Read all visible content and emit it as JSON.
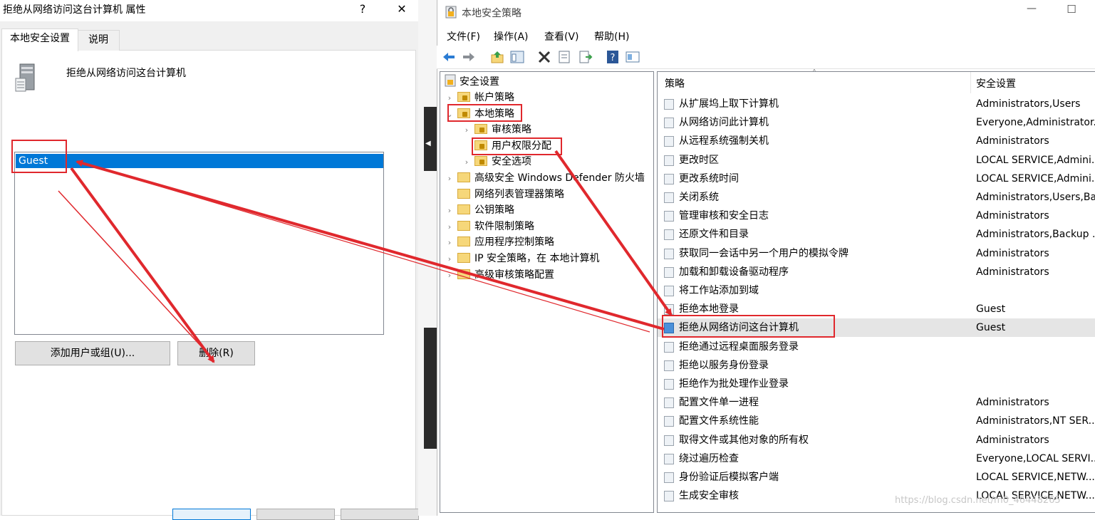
{
  "dialog": {
    "title": "拒绝从网络访问这台计算机 属性",
    "help_glyph": "?",
    "close_glyph": "✕",
    "tabs": [
      "本地安全设置",
      "说明"
    ],
    "policy_name": "拒绝从网络访问这台计算机",
    "members": [
      "Guest"
    ],
    "add_button": "添加用户或组(U)...",
    "remove_button": "删除(R)"
  },
  "mmc": {
    "title": "本地安全策略",
    "minimize_glyph": "—",
    "maximize_glyph": "☐",
    "menu": [
      "文件(F)",
      "操作(A)",
      "查看(V)",
      "帮助(H)"
    ],
    "toolbar_icons": [
      "back-arrow-icon",
      "forward-arrow-icon",
      "up-folder-icon",
      "show-hide-tree-icon",
      "delete-icon",
      "properties-icon",
      "export-list-icon",
      "help-icon",
      "console-icon"
    ],
    "tree": {
      "root": "安全设置",
      "items": [
        {
          "label": "帐户策略",
          "level": 1,
          "expander": "›",
          "lock": true
        },
        {
          "label": "本地策略",
          "level": 1,
          "expander": "⌄",
          "lock": true
        },
        {
          "label": "审核策略",
          "level": 2,
          "expander": "›",
          "lock": true
        },
        {
          "label": "用户权限分配",
          "level": 2,
          "expander": "",
          "lock": true
        },
        {
          "label": "安全选项",
          "level": 2,
          "expander": "›",
          "lock": true
        },
        {
          "label": "高级安全 Windows Defender 防火墙",
          "level": 1,
          "expander": "›",
          "lock": false
        },
        {
          "label": "网络列表管理器策略",
          "level": 1,
          "expander": "",
          "lock": false
        },
        {
          "label": "公钥策略",
          "level": 1,
          "expander": "›",
          "lock": false
        },
        {
          "label": "软件限制策略",
          "level": 1,
          "expander": "›",
          "lock": false
        },
        {
          "label": "应用程序控制策略",
          "level": 1,
          "expander": "›",
          "lock": false
        },
        {
          "label": "IP 安全策略，在 本地计算机",
          "level": 1,
          "expander": "›",
          "lock": false
        },
        {
          "label": "高级审核策略配置",
          "level": 1,
          "expander": "›",
          "lock": false
        }
      ]
    },
    "columns": [
      "策略",
      "安全设置"
    ],
    "sort_glyph": "˄",
    "policies": [
      {
        "name": "从扩展坞上取下计算机",
        "setting": "Administrators,Users"
      },
      {
        "name": "从网络访问此计算机",
        "setting": "Everyone,Administrator..."
      },
      {
        "name": "从远程系统强制关机",
        "setting": "Administrators"
      },
      {
        "name": "更改时区",
        "setting": "LOCAL SERVICE,Admini..."
      },
      {
        "name": "更改系统时间",
        "setting": "LOCAL SERVICE,Admini..."
      },
      {
        "name": "关闭系统",
        "setting": "Administrators,Users,Ba..."
      },
      {
        "name": "管理审核和安全日志",
        "setting": "Administrators"
      },
      {
        "name": "还原文件和目录",
        "setting": "Administrators,Backup ..."
      },
      {
        "name": "获取同一会话中另一个用户的模拟令牌",
        "setting": "Administrators"
      },
      {
        "name": "加载和卸载设备驱动程序",
        "setting": "Administrators"
      },
      {
        "name": "将工作站添加到域",
        "setting": ""
      },
      {
        "name": "拒绝本地登录",
        "setting": "Guest"
      },
      {
        "name": "拒绝从网络访问这台计算机",
        "setting": "Guest"
      },
      {
        "name": "拒绝通过远程桌面服务登录",
        "setting": ""
      },
      {
        "name": "拒绝以服务身份登录",
        "setting": ""
      },
      {
        "name": "拒绝作为批处理作业登录",
        "setting": ""
      },
      {
        "name": "配置文件单一进程",
        "setting": "Administrators"
      },
      {
        "name": "配置文件系统性能",
        "setting": "Administrators,NT SER..."
      },
      {
        "name": "取得文件或其他对象的所有权",
        "setting": "Administrators"
      },
      {
        "name": "绕过遍历检查",
        "setting": "Everyone,LOCAL SERVI..."
      },
      {
        "name": "身份验证后模拟客户端",
        "setting": "LOCAL SERVICE,NETW..."
      },
      {
        "name": "生成安全审核",
        "setting": "LOCAL SERVICE,NETW..."
      }
    ],
    "selected_policy_index": 12
  },
  "watermark": "https://blog.csdn.net/m0_46448265",
  "colors": {
    "accent": "#0078d7",
    "annotation": "#e0282d"
  }
}
